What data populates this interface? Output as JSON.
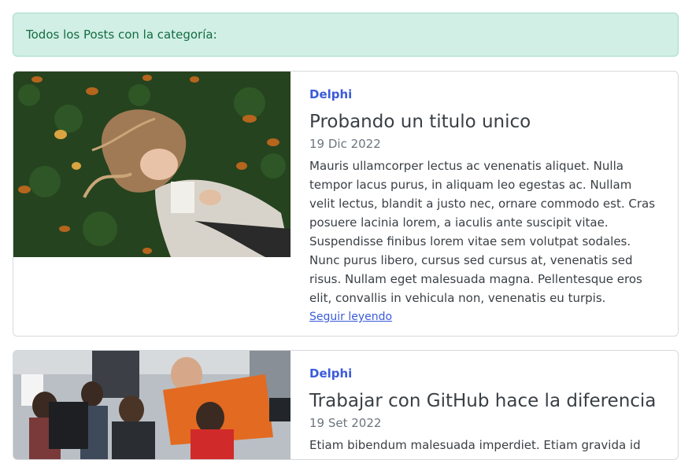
{
  "alert": {
    "text": "Todos los Posts con la categoría:"
  },
  "posts": [
    {
      "category": "Delphi",
      "title": "Probando un titulo unico",
      "date": "19 Dic 2022",
      "excerpt": "Mauris ullamcorper lectus ac venenatis aliquet. Nulla tempor lacus purus, in aliquam leo egestas ac. Nullam velit lectus, blandit a justo nec, ornare commodo est. Cras posuere lacinia lorem, a iaculis ante suscipit vitae. Suspendisse finibus lorem vitae sem volutpat sodales. Nunc purus libero, cursus sed cursus at, venenatis sed risus. Nullam eget malesuada magna. Pellentesque eros elit, convallis in vehicula non, venenatis eu turpis.",
      "read_more": "Seguir leyendo"
    },
    {
      "category": "Delphi",
      "title": "Trabajar con GitHub hace la diferencia",
      "date": "19 Set 2022",
      "excerpt": "Etiam bibendum malesuada imperdiet. Etiam gravida id"
    }
  ]
}
